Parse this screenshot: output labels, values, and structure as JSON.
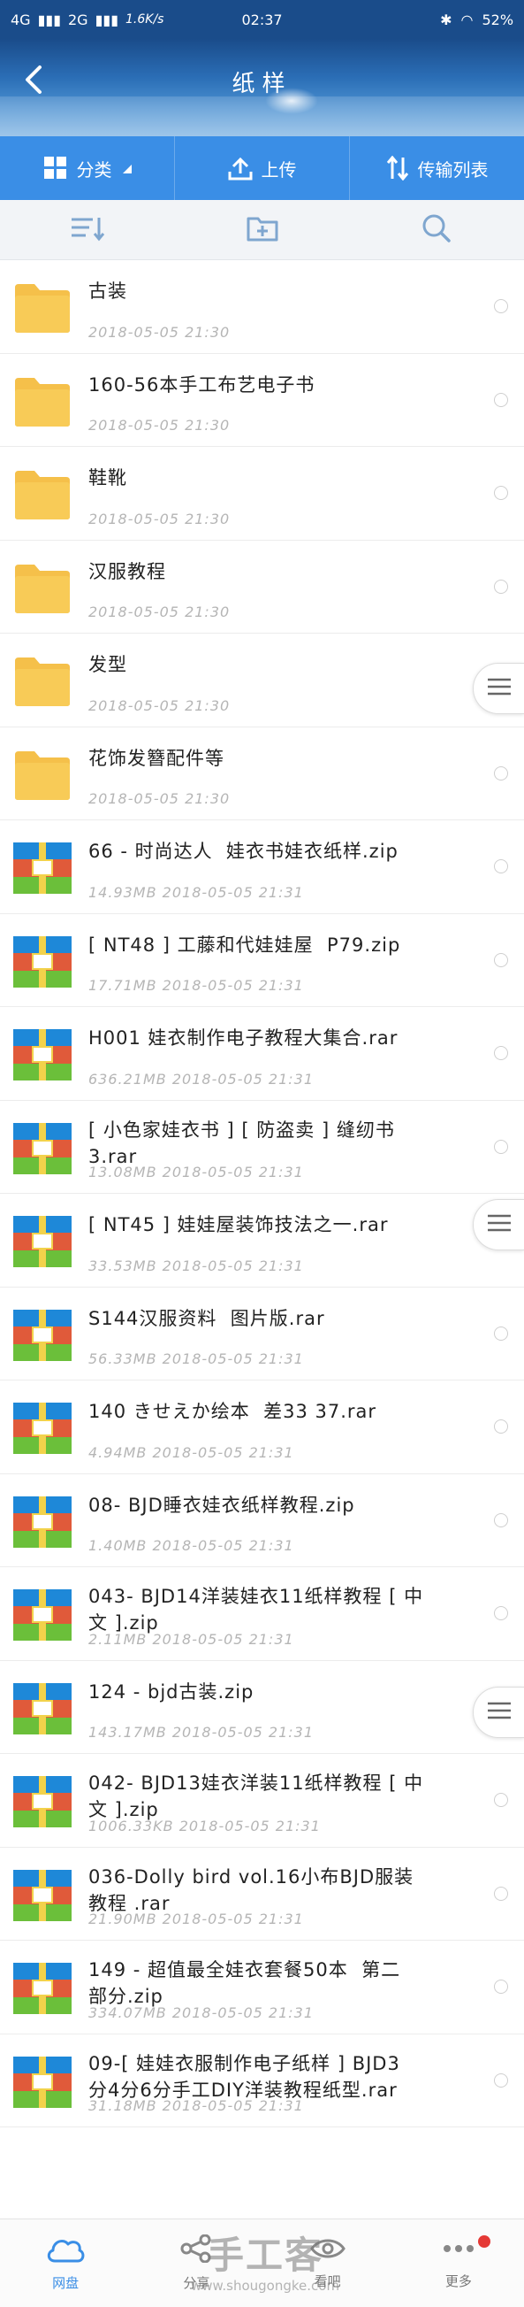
{
  "status_bar": {
    "network_left": "4G",
    "network_right": "2G",
    "speed": "1.6K/s",
    "time": "02:37",
    "battery": "52%"
  },
  "header": {
    "title": "纸样"
  },
  "actions": [
    {
      "label": "分类",
      "icon": "grid-icon"
    },
    {
      "label": "上传",
      "icon": "upload-icon"
    },
    {
      "label": "传输列表",
      "icon": "transfer-icon"
    }
  ],
  "toolbar": {
    "icons": [
      "sort-icon",
      "new-folder-icon",
      "search-icon"
    ]
  },
  "files": [
    {
      "type": "folder",
      "name": "古装",
      "meta": "2018-05-05   21:30"
    },
    {
      "type": "folder",
      "name": "160-56本手工布艺电子书",
      "meta": "2018-05-05   21:30"
    },
    {
      "type": "folder",
      "name": "鞋靴",
      "meta": "2018-05-05   21:30"
    },
    {
      "type": "folder",
      "name": "汉服教程",
      "meta": "2018-05-05   21:30"
    },
    {
      "type": "folder",
      "name": "发型",
      "meta": "2018-05-05   21:30"
    },
    {
      "type": "folder",
      "name": "花饰发簪配件等",
      "meta": "2018-05-05   21:30"
    },
    {
      "type": "archive",
      "name": "66 - 时尚达人  娃衣书娃衣纸样.zip",
      "meta": "14.93MB  2018-05-05   21:31"
    },
    {
      "type": "archive",
      "name": "[ NT48 ] 工藤和代娃娃屋  P79.zip",
      "meta": "17.71MB  2018-05-05   21:31"
    },
    {
      "type": "archive",
      "name": "H001 娃衣制作电子教程大集合.rar",
      "meta": "636.21MB  2018-05-05   21:31"
    },
    {
      "type": "archive",
      "name": "[ 小色家娃衣书 ] [ 防盗卖 ] 缝纫书\n3.rar",
      "meta": "13.08MB  2018-05-05   21:31"
    },
    {
      "type": "archive",
      "name": "[ NT45 ] 娃娃屋装饰技法之一.rar",
      "meta": "33.53MB  2018-05-05   21:31"
    },
    {
      "type": "archive",
      "name": "S144汉服资料  图片版.rar",
      "meta": "56.33MB  2018-05-05   21:31"
    },
    {
      "type": "archive",
      "name": "140 きせえか绘本  差33 37.rar",
      "meta": "4.94MB  2018-05-05   21:31"
    },
    {
      "type": "archive",
      "name": "08- BJD睡衣娃衣纸样教程.zip",
      "meta": "1.40MB  2018-05-05   21:31"
    },
    {
      "type": "archive",
      "name": "043- BJD14洋装娃衣11纸样教程 [ 中\n文 ].zip",
      "meta": "2.11MB  2018-05-05   21:31"
    },
    {
      "type": "archive",
      "name": "124 - bjd古装.zip",
      "meta": "143.17MB  2018-05-05   21:31"
    },
    {
      "type": "archive",
      "name": "042- BJD13娃衣洋装11纸样教程 [ 中\n文 ].zip",
      "meta": "1006.33KB  2018-05-05   21:31"
    },
    {
      "type": "archive",
      "name": "036-Dolly bird vol.16小布BJD服装\n教程 .rar",
      "meta": "21.90MB  2018-05-05   21:31"
    },
    {
      "type": "archive",
      "name": "149 - 超值最全娃衣套餐50本  第二\n部分.zip",
      "meta": "334.07MB  2018-05-05   21:31"
    },
    {
      "type": "archive",
      "name": "09-[ 娃娃衣服制作电子纸样 ] BJD3\n分4分6分手工DIY洋装教程纸型.rar",
      "meta": "31.18MB  2018-05-05   21:31"
    }
  ],
  "bottom_nav": [
    {
      "label": "网盘",
      "icon": "cloud-icon",
      "active": true
    },
    {
      "label": "分享",
      "icon": "share-icon",
      "active": false
    },
    {
      "label": "看吧",
      "icon": "eye-icon",
      "active": false
    },
    {
      "label": "更多",
      "icon": "more-icon",
      "active": false,
      "badge": true
    }
  ],
  "watermark": {
    "main": "手工客",
    "sub": "www.shougongke.com"
  },
  "colors": {
    "accent": "#3a8ee6",
    "folder": "#f5c04a",
    "archive_blue": "#1e88d8",
    "archive_red": "#e05a3a",
    "archive_green": "#6bbf3a"
  }
}
